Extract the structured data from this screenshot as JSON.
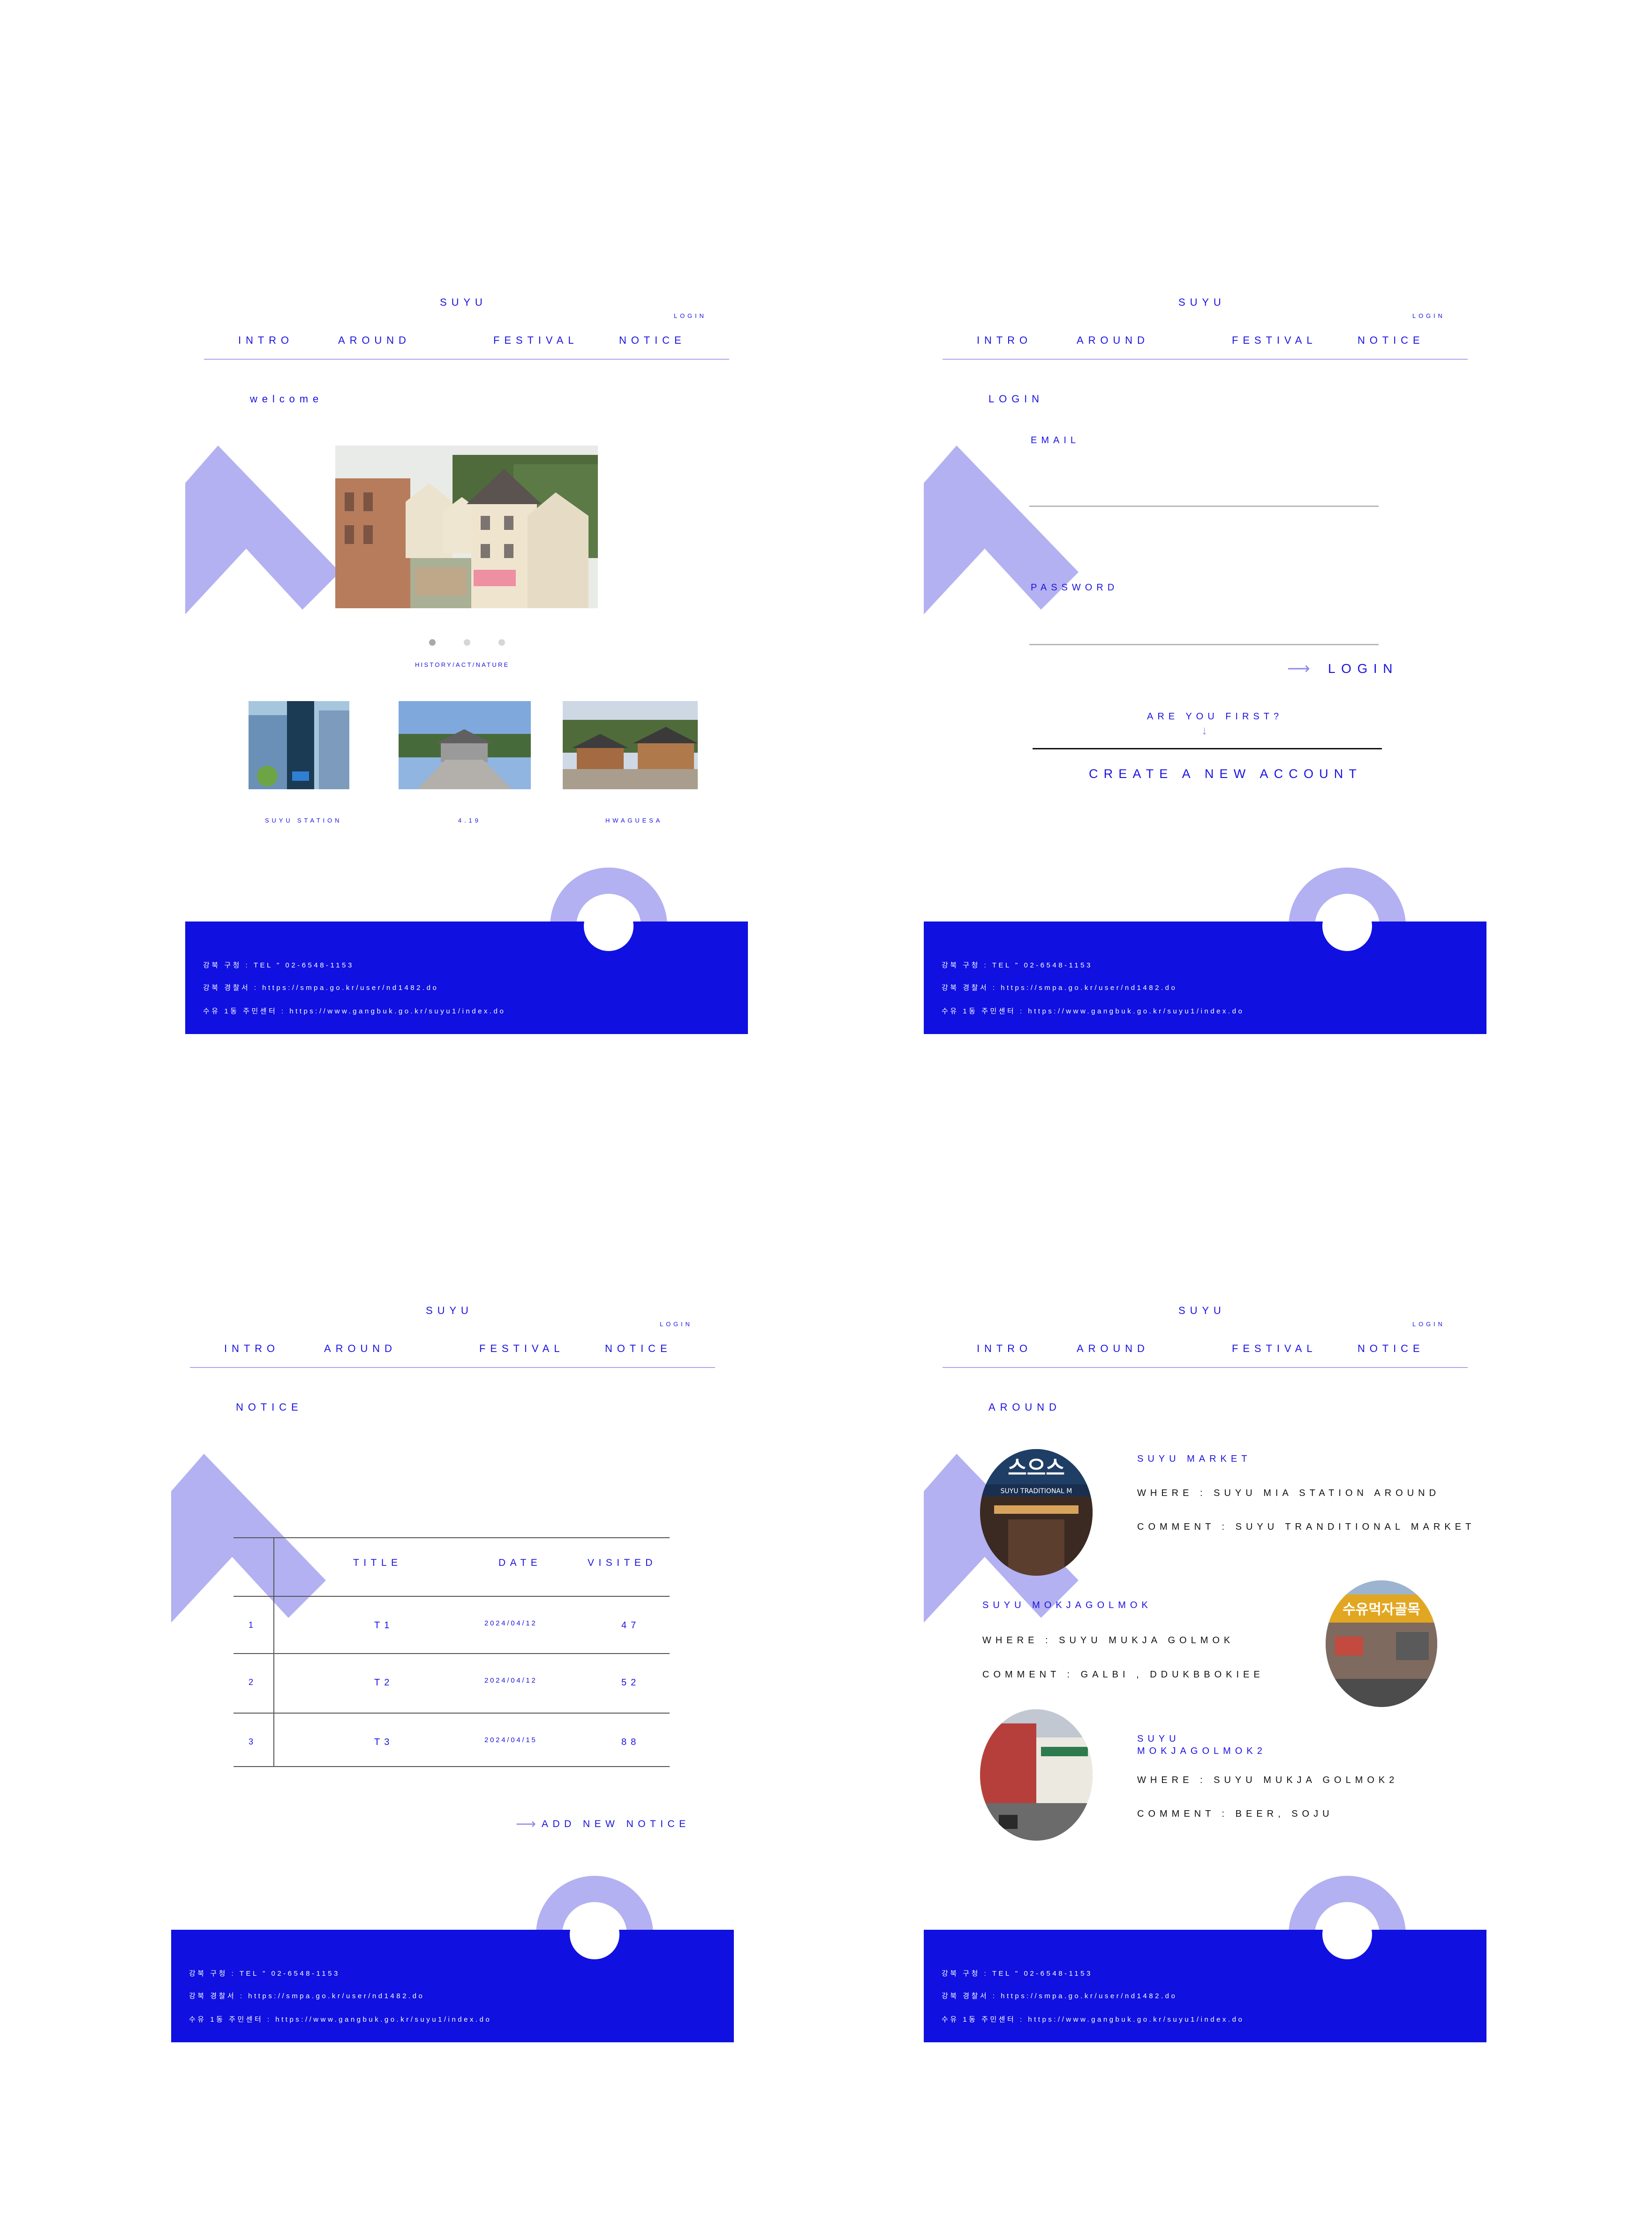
{
  "header": {
    "logo": "SUYU",
    "login_link": "LOGIN",
    "nav": [
      "INTRO",
      "AROUND",
      "FESTIVAL",
      "NOTICE"
    ]
  },
  "footer": {
    "line1": "강북 구청 : TEL \" 02-6548-1153",
    "line2": "강북 경찰서 : https://smpa.go.kr/user/nd1482.do",
    "line3": "수유 1동 주민센터 : https://www.gangbuk.go.kr/suyu1/index.do"
  },
  "colors": {
    "primary": "#1a12e0",
    "accent_light": "#b3b1f1",
    "footer_bg": "#1010e0"
  },
  "home": {
    "welcome": "welcome",
    "carousel_caption": "HISTORY/ACT/NATURE",
    "thumbnails": [
      {
        "caption": "SUYU STATION",
        "icon": "station-photo"
      },
      {
        "caption": "4.19",
        "icon": "memorial-photo"
      },
      {
        "caption": "HWAGUESA",
        "icon": "temple-photo"
      }
    ]
  },
  "login_page": {
    "title": "LOGIN",
    "email_label": "EMAIL",
    "password_label": "PASSWORD",
    "login_button": "LOGIN",
    "are_you_first": "ARE YOU FIRST?",
    "create_account": "CREATE A NEW ACCOUNT",
    "arrow_right": "⟶",
    "arrow_down": "↓"
  },
  "notice_page": {
    "title": "NOTICE",
    "columns": [
      "TITLE",
      "DATE",
      "VISITED"
    ],
    "rows": [
      {
        "num": "1",
        "title": "T1",
        "date": "2024/04/12",
        "visited": "47"
      },
      {
        "num": "2",
        "title": "T2",
        "date": "2024/04/12",
        "visited": "52"
      },
      {
        "num": "3",
        "title": "T3",
        "date": "2024/04/15",
        "visited": "88"
      }
    ],
    "add_notice": "ADD NEW NOTICE",
    "arrow_right": "⟶"
  },
  "around_page": {
    "title": "AROUND",
    "places": [
      {
        "name": "SUYU MARKET",
        "where": "WHERE : SUYU MIA STATION AROUND",
        "comment": "COMMENT : SUYU TRANDITIONAL MARKET"
      },
      {
        "name": "SUYU MOKJAGOLMOK",
        "where": "WHERE : SUYU MUKJA GOLMOK",
        "comment": "COMMENT : GALBI , DDUKBBOKIEE"
      },
      {
        "name": "SUYU\nMOKJAGOLMOK2",
        "where": "WHERE : SUYU MUKJA GOLMOK2",
        "comment": "COMMENT : BEER, SOJU"
      }
    ],
    "market_sign": "스으스",
    "market_sign_sub": "SUYU TRADITIONAL M",
    "alley_sign": "수유먹자골목"
  }
}
